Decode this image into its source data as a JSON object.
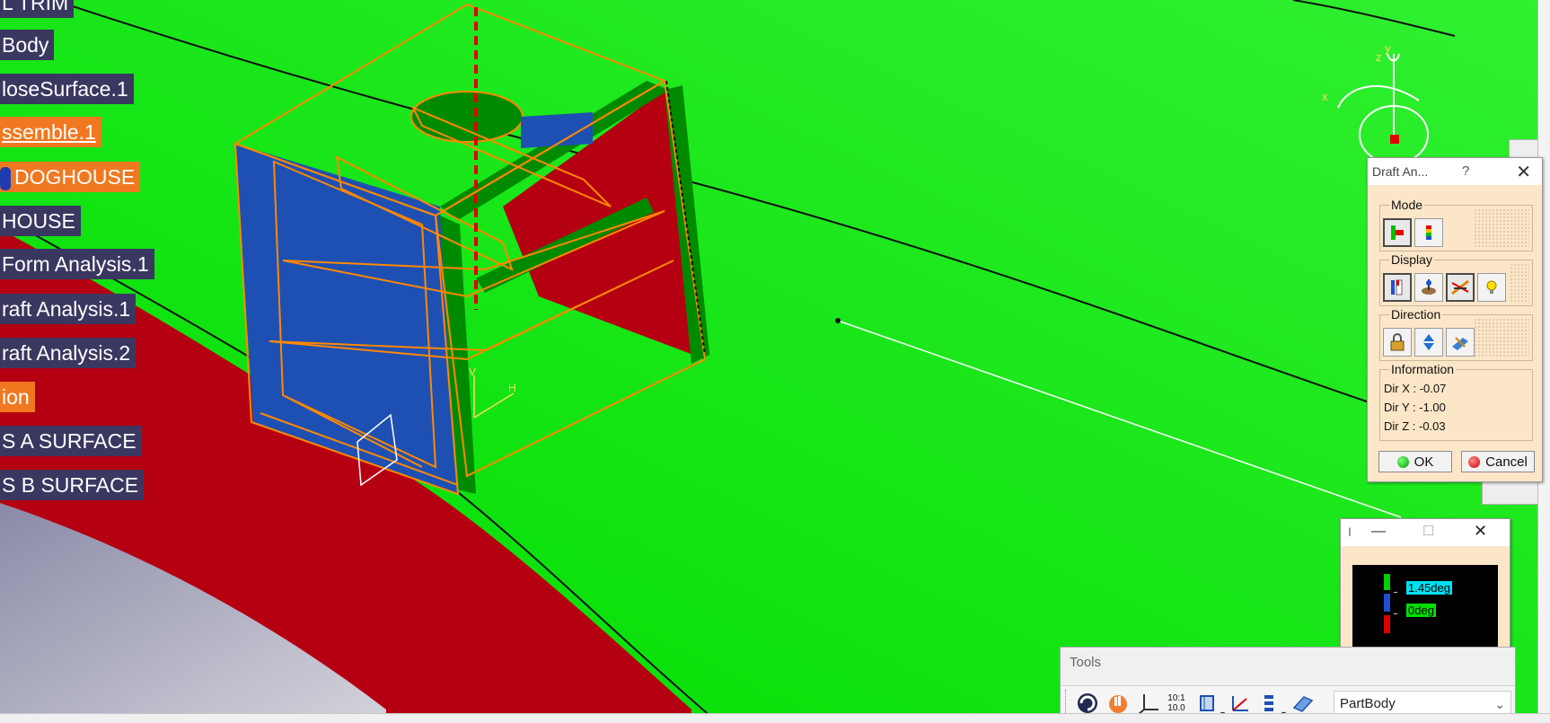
{
  "spec_tree": {
    "items": [
      {
        "label": "L TRIM",
        "style": "dark"
      },
      {
        "label": "Body",
        "style": "dark"
      },
      {
        "label": "loseSurface.1",
        "style": "dark"
      },
      {
        "label": "ssemble.1",
        "style": "orange-underline"
      },
      {
        "label": "DOGHOUSE",
        "style": "orange-icon"
      },
      {
        "label": " HOUSE",
        "style": "dark"
      },
      {
        "label": "Form Analysis.1",
        "style": "dark"
      },
      {
        "label": "raft Analysis.1",
        "style": "dark"
      },
      {
        "label": "raft Analysis.2",
        "style": "dark"
      },
      {
        "label": "ion",
        "style": "orange"
      },
      {
        "label": "S A SURFACE",
        "style": "dark"
      },
      {
        "label": "S B SURFACE",
        "style": "dark"
      }
    ]
  },
  "compass": {
    "x_label": "x",
    "y_label": "y",
    "z_label": "z"
  },
  "part_axis": {
    "v_label": "V",
    "h_label": "H"
  },
  "draft_dialog": {
    "title": "Draft An...",
    "help": "?",
    "close": "✕",
    "groups": {
      "mode": "Mode",
      "display": "Display",
      "direction": "Direction",
      "information": "Information"
    },
    "info": {
      "dir_x": "Dir X : -0.07",
      "dir_y": "Dir Y : -1.00",
      "dir_z": "Dir Z : -0.03"
    },
    "ok_label": "OK",
    "cancel_label": "Cancel"
  },
  "scale_window": {
    "title": "I",
    "minimize": "—",
    "maximize": "☐",
    "close": "✕",
    "upper_value": "1.45deg",
    "lower_value": "0deg"
  },
  "tools_toolbar": {
    "title": "Tools",
    "ratio_top": "10:1",
    "ratio_bottom": "10.0",
    "body_selector": "PartBody"
  },
  "colors": {
    "surface_green": "#00e600",
    "draft_red": "#b80010",
    "draft_blue": "#1e50b4",
    "wireframe_orange": "#ff8800",
    "tree_dark": "#3a3860",
    "tree_orange": "#f07820",
    "dialog_bg": "#fbe6c8"
  }
}
